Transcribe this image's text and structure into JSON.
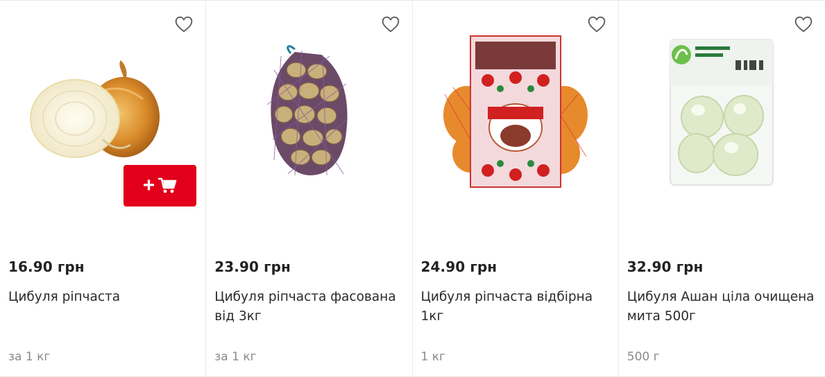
{
  "colors": {
    "accent": "#e2001a",
    "price_text": "#222222",
    "muted_text": "#8a8a8a"
  },
  "products": [
    {
      "price": "16.90 грн",
      "name": "Цибуля ріпчаста",
      "unit": "за 1 кг",
      "image": "whole-and-halved-onion",
      "favorite_icon": "heart-icon"
    },
    {
      "price": "23.90 грн",
      "name": "Цибуля ріпчаста фасована від 3кг",
      "unit": "за 1 кг",
      "image": "onions-in-net-bag",
      "favorite_icon": "heart-icon"
    },
    {
      "price": "24.90 грн",
      "name": "Цибуля ріпчаста відбірна 1кг",
      "unit": "1 кг",
      "image": "onions-in-decorated-pack",
      "favorite_icon": "heart-icon"
    },
    {
      "price": "32.90 грн",
      "name": "Цибуля Ашан ціла очищена мита 500г",
      "unit": "500 г",
      "image": "peeled-onions-in-plastic-pack",
      "favorite_icon": "heart-icon"
    }
  ],
  "add_to_cart": {
    "plus_symbol": "+",
    "icon": "cart-icon"
  }
}
